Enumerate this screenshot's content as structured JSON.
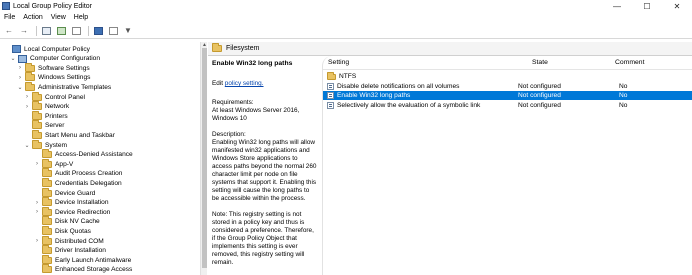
{
  "window": {
    "title": "Local Group Policy Editor",
    "controls": {
      "minimize": "—",
      "maximize": "☐",
      "close": "✕"
    }
  },
  "menu": [
    "File",
    "Action",
    "View",
    "Help"
  ],
  "tree": {
    "items": [
      {
        "label": "Local Computer Policy",
        "level": 0,
        "expander": "",
        "icon": "computer-policy-icon"
      },
      {
        "label": "Computer Configuration",
        "level": 1,
        "expander": "⌄",
        "icon": "computer-icon"
      },
      {
        "label": "Software Settings",
        "level": 2,
        "expander": "›",
        "icon": "folder-icon"
      },
      {
        "label": "Windows Settings",
        "level": 2,
        "expander": "›",
        "icon": "folder-icon"
      },
      {
        "label": "Administrative Templates",
        "level": 2,
        "expander": "⌄",
        "icon": "folder-icon"
      },
      {
        "label": "Control Panel",
        "level": 3,
        "expander": "›",
        "icon": "folder-icon"
      },
      {
        "label": "Network",
        "level": 3,
        "expander": "›",
        "icon": "folder-icon"
      },
      {
        "label": "Printers",
        "level": 3,
        "expander": "",
        "icon": "folder-icon"
      },
      {
        "label": "Server",
        "level": 3,
        "expander": "",
        "icon": "folder-icon"
      },
      {
        "label": "Start Menu and Taskbar",
        "level": 3,
        "expander": "",
        "icon": "folder-icon"
      },
      {
        "label": "System",
        "level": 3,
        "expander": "⌄",
        "icon": "folder-icon"
      },
      {
        "label": "Access-Denied Assistance",
        "level": 4,
        "expander": "",
        "icon": "folder-icon"
      },
      {
        "label": "App-V",
        "level": 4,
        "expander": "›",
        "icon": "folder-icon"
      },
      {
        "label": "Audit Process Creation",
        "level": 4,
        "expander": "",
        "icon": "folder-icon"
      },
      {
        "label": "Credentials Delegation",
        "level": 4,
        "expander": "",
        "icon": "folder-icon"
      },
      {
        "label": "Device Guard",
        "level": 4,
        "expander": "",
        "icon": "folder-icon"
      },
      {
        "label": "Device Installation",
        "level": 4,
        "expander": "›",
        "icon": "folder-icon"
      },
      {
        "label": "Device Redirection",
        "level": 4,
        "expander": "›",
        "icon": "folder-icon"
      },
      {
        "label": "Disk NV Cache",
        "level": 4,
        "expander": "",
        "icon": "folder-icon"
      },
      {
        "label": "Disk Quotas",
        "level": 4,
        "expander": "",
        "icon": "folder-icon"
      },
      {
        "label": "Distributed COM",
        "level": 4,
        "expander": "›",
        "icon": "folder-icon"
      },
      {
        "label": "Driver Installation",
        "level": 4,
        "expander": "",
        "icon": "folder-icon"
      },
      {
        "label": "Early Launch Antimalware",
        "level": 4,
        "expander": "",
        "icon": "folder-icon"
      },
      {
        "label": "Enhanced Storage Access",
        "level": 4,
        "expander": "",
        "icon": "folder-icon"
      }
    ]
  },
  "content": {
    "header": "Filesystem",
    "description": {
      "title": "Enable Win32 long paths",
      "edit_prefix": "Edit ",
      "edit_link": "policy setting.",
      "requirements_label": "Requirements:",
      "requirements": "At least Windows Server 2016, Windows 10",
      "description_label": "Description:",
      "description": "Enabling Win32 long paths will allow manifested win32 applications and Windows Store applications to access paths beyond the normal 260 character limit per node on file systems that support it.  Enabling this setting will cause the long paths to be accessible within the process.",
      "note": "Note:  This registry setting is not stored in a policy key and thus is considered a preference.  Therefore, if the Group Policy Object that implements this setting is ever removed, this registry setting will remain."
    },
    "columns": {
      "setting": "Setting",
      "state": "State",
      "comment": "Comment"
    },
    "rows": [
      {
        "setting": "NTFS",
        "state": "",
        "comment": "",
        "type": "folder"
      },
      {
        "setting": "Disable delete notifications on all volumes",
        "state": "Not configured",
        "comment": "No",
        "type": "setting"
      },
      {
        "setting": "Enable Win32 long paths",
        "state": "Not configured",
        "comment": "No",
        "type": "setting",
        "selected": true
      },
      {
        "setting": "Selectively allow the evaluation of a symbolic link",
        "state": "Not configured",
        "comment": "No",
        "type": "setting"
      }
    ]
  },
  "colors": {
    "selection": "#0078d7",
    "folder": "#e8c262",
    "link": "#0645ad"
  }
}
